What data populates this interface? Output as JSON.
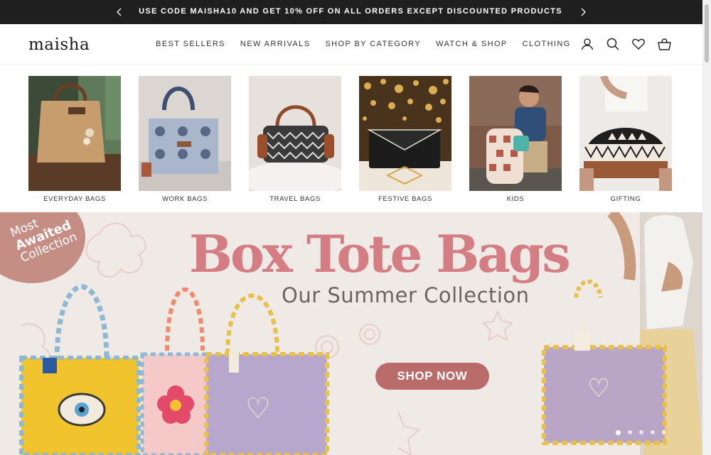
{
  "announcement": {
    "text": "USE CODE MAISHA10 AND GET 10% OFF ON ALL ORDERS EXCEPT DISCOUNTED PRODUCTS",
    "prev_icon": "chevron-left-icon",
    "next_icon": "chevron-right-icon"
  },
  "header": {
    "logo": "maisha",
    "nav": [
      "BEST SELLERS",
      "NEW ARRIVALS",
      "SHOP BY CATEGORY",
      "WATCH & SHOP",
      "CLOTHING"
    ],
    "icons": [
      "account-icon",
      "search-icon",
      "wishlist-heart-icon",
      "cart-bag-icon"
    ]
  },
  "categories": [
    {
      "label": "EVERYDAY BAGS"
    },
    {
      "label": "WORK BAGS"
    },
    {
      "label": "TRAVEL BAGS"
    },
    {
      "label": "FESTIVE BAGS"
    },
    {
      "label": "KIDS"
    },
    {
      "label": "GIFTING"
    }
  ],
  "hero": {
    "badge": [
      "Most",
      "Awaited",
      "Collection"
    ],
    "headline": "Box Tote Bags",
    "subheadline": "Our Summer Collection",
    "cta": "SHOP NOW",
    "slides": 5,
    "active_slide": 1
  },
  "colors": {
    "announcement_bg": "#1f1f1f",
    "hero_bg": "#efeae6",
    "headline": "#d47d82",
    "cta_bg": "#ba6c6a",
    "badge_bg": "#c48e85"
  }
}
